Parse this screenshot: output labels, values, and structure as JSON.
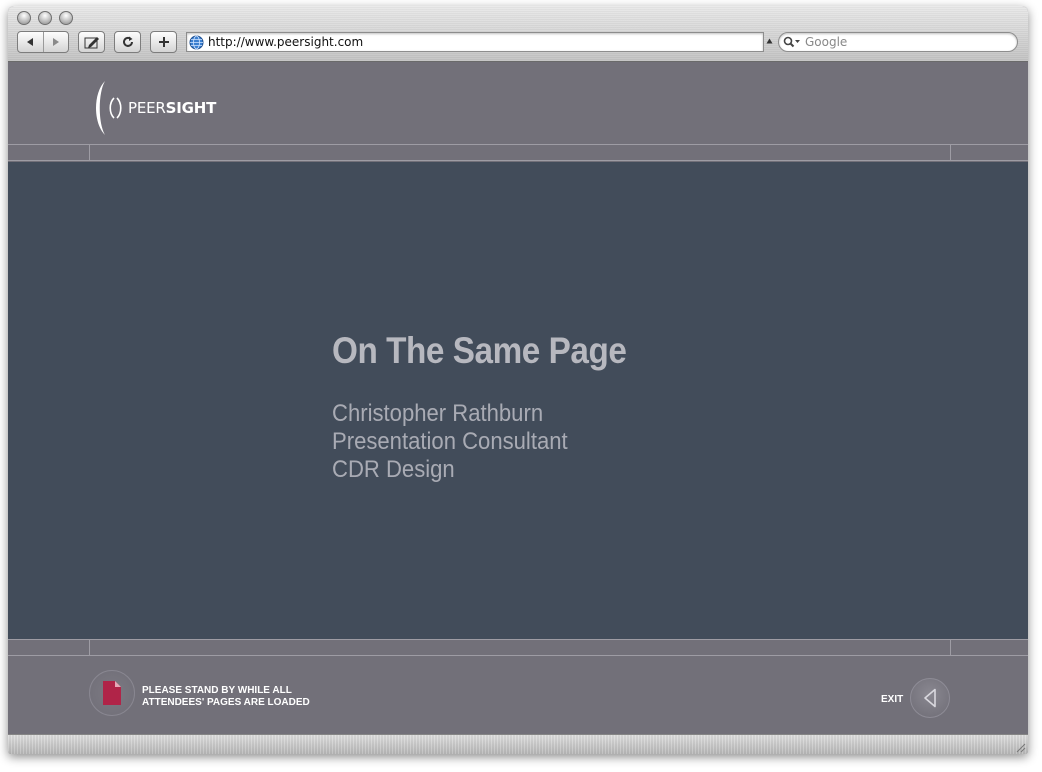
{
  "browser": {
    "url": "http://www.peersight.com",
    "search_placeholder": "Google"
  },
  "brand": {
    "name_thin": "PEER",
    "name_bold": "SIGHT"
  },
  "slide": {
    "title": "On The Same Page",
    "lines": [
      "Christopher Rathburn",
      "Presentation Consultant",
      "CDR Design"
    ]
  },
  "footer": {
    "status_line1": "PLEASE STAND BY WHILE ALL",
    "status_line2": "ATTENDEES' PAGES ARE LOADED",
    "exit_label": "EXIT"
  },
  "colors": {
    "chrome_bg": "#727079",
    "slide_bg": "#424c5a",
    "document_icon": "#b02448"
  },
  "icons": {
    "back": "back-arrow-icon",
    "forward": "forward-arrow-icon",
    "bookmark": "pencil-icon",
    "reload": "reload-icon",
    "add": "plus-icon",
    "site": "globe-icon",
    "search": "magnifier-icon",
    "document": "document-icon",
    "exit": "triangle-left-icon"
  }
}
